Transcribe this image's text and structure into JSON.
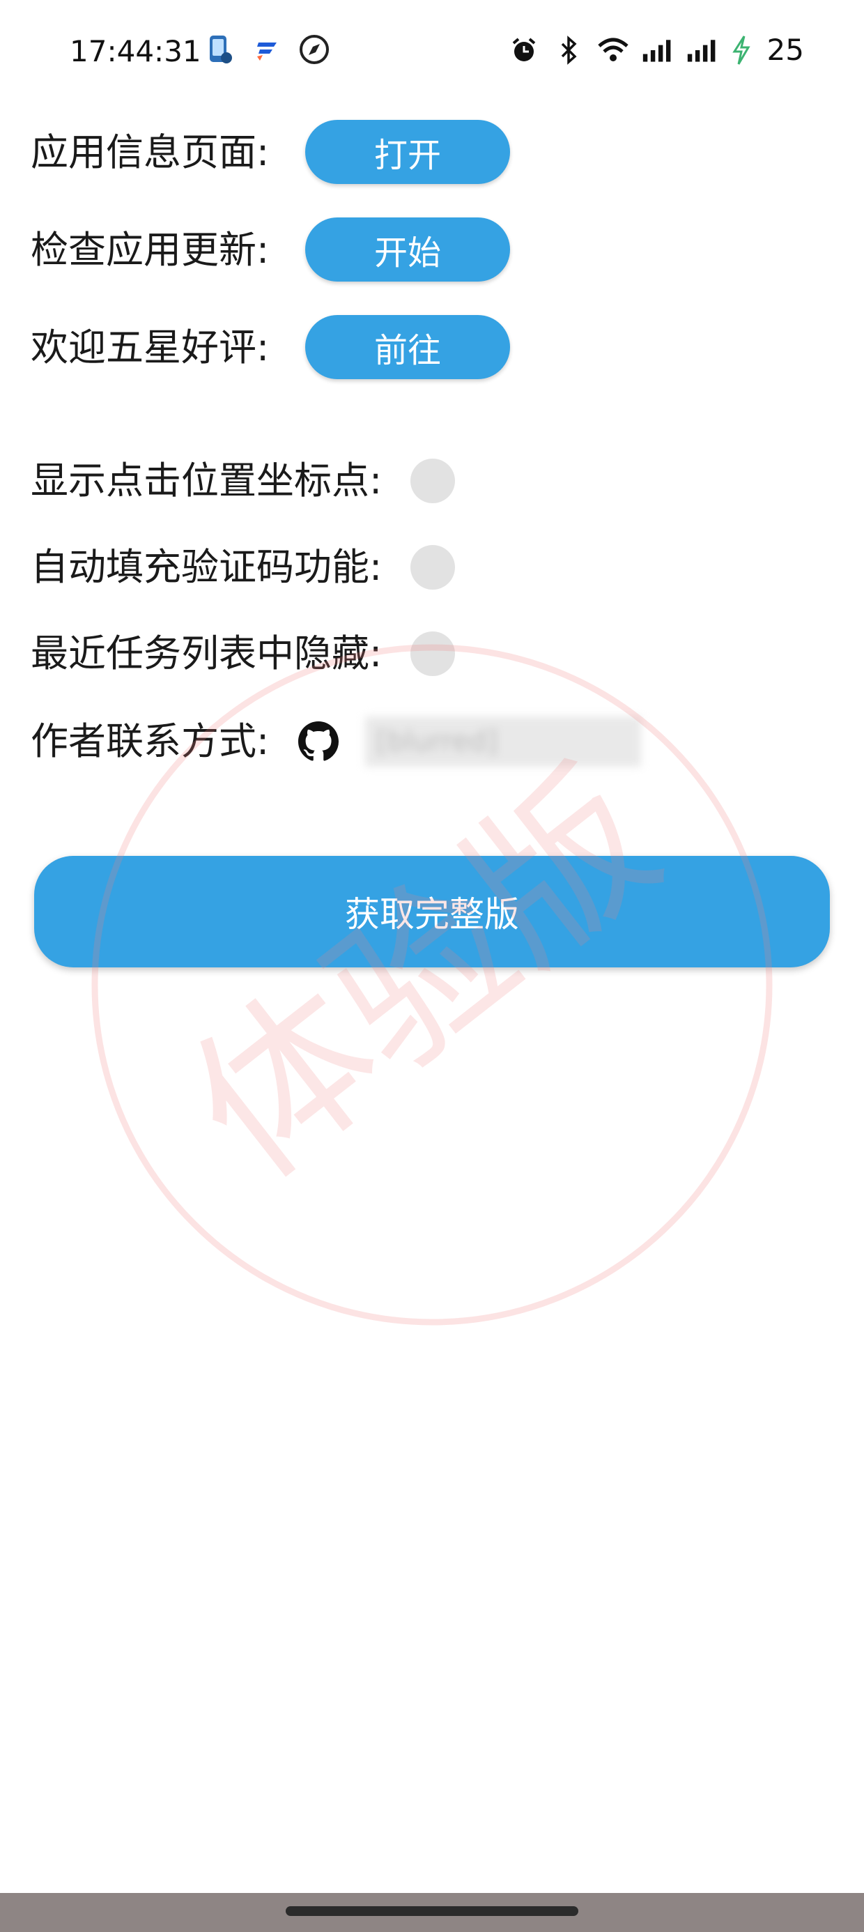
{
  "status_bar": {
    "time": "17:44:31",
    "battery_level": "25",
    "left_icons": [
      "phone-app-icon",
      "feishu-icon",
      "compass-icon"
    ],
    "right_icons": [
      "alarm-icon",
      "bluetooth-icon",
      "wifi-icon",
      "signal-icon",
      "signal-icon",
      "charging-icon"
    ],
    "charging_color": "#3cb371"
  },
  "settings": {
    "app_info": {
      "label": "应用信息页面:",
      "button": "打开"
    },
    "check_update": {
      "label": "检查应用更新:",
      "button": "开始"
    },
    "rate": {
      "label": "欢迎五星好评:",
      "button": "前往"
    },
    "show_touch": {
      "label": "显示点击位置坐标点:",
      "enabled": false
    },
    "auto_fill_code": {
      "label": "自动填充验证码功能:",
      "enabled": false
    },
    "hide_recents": {
      "label": "最近任务列表中隐藏:",
      "enabled": false
    },
    "author_contact": {
      "label": "作者联系方式:",
      "icon": "github-icon",
      "value": "[blurred]"
    }
  },
  "cta": {
    "label": "获取完整版"
  },
  "watermark": {
    "text": "体验版",
    "color": "#f08080"
  },
  "colors": {
    "accent": "#35a2e3",
    "toggle_off": "#e2e2e2"
  }
}
